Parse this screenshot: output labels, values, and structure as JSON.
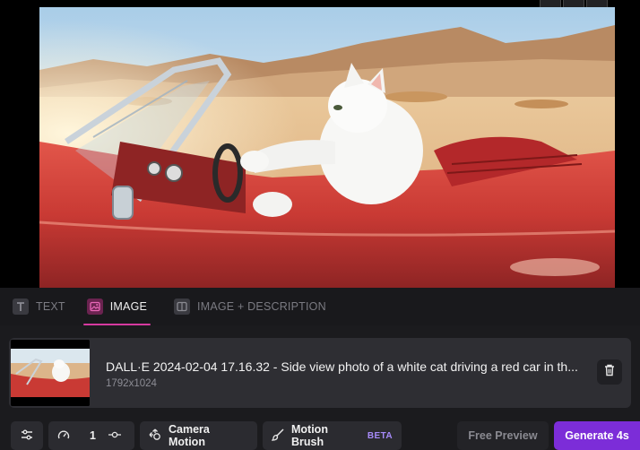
{
  "preview": {
    "image_alt": "White cat driving a red convertible car in the desert"
  },
  "tabs": [
    {
      "label": "TEXT",
      "icon": "text-icon",
      "active": false
    },
    {
      "label": "IMAGE",
      "icon": "image-icon",
      "active": true
    },
    {
      "label": "IMAGE + DESCRIPTION",
      "icon": "image-description-icon",
      "active": false
    }
  ],
  "file": {
    "name": "DALL·E 2024-02-04 17.16.32 - Side view photo of a white cat driving a red car in th...",
    "dimensions": "1792x1024"
  },
  "toolbar": {
    "settings_icon": "sliders-icon",
    "speed_icon": "speedometer-icon",
    "seed_value": "1",
    "seed_icon": "seed-icon",
    "camera_motion_label": "Camera Motion",
    "motion_brush_label": "Motion Brush",
    "motion_brush_badge": "BETA",
    "free_preview_label": "Free Preview",
    "generate_label": "Generate 4s"
  },
  "colors": {
    "accent_pink": "#d63aa0",
    "generate_purple": "#7c2dd8",
    "beta_violet": "#a78bfa"
  }
}
